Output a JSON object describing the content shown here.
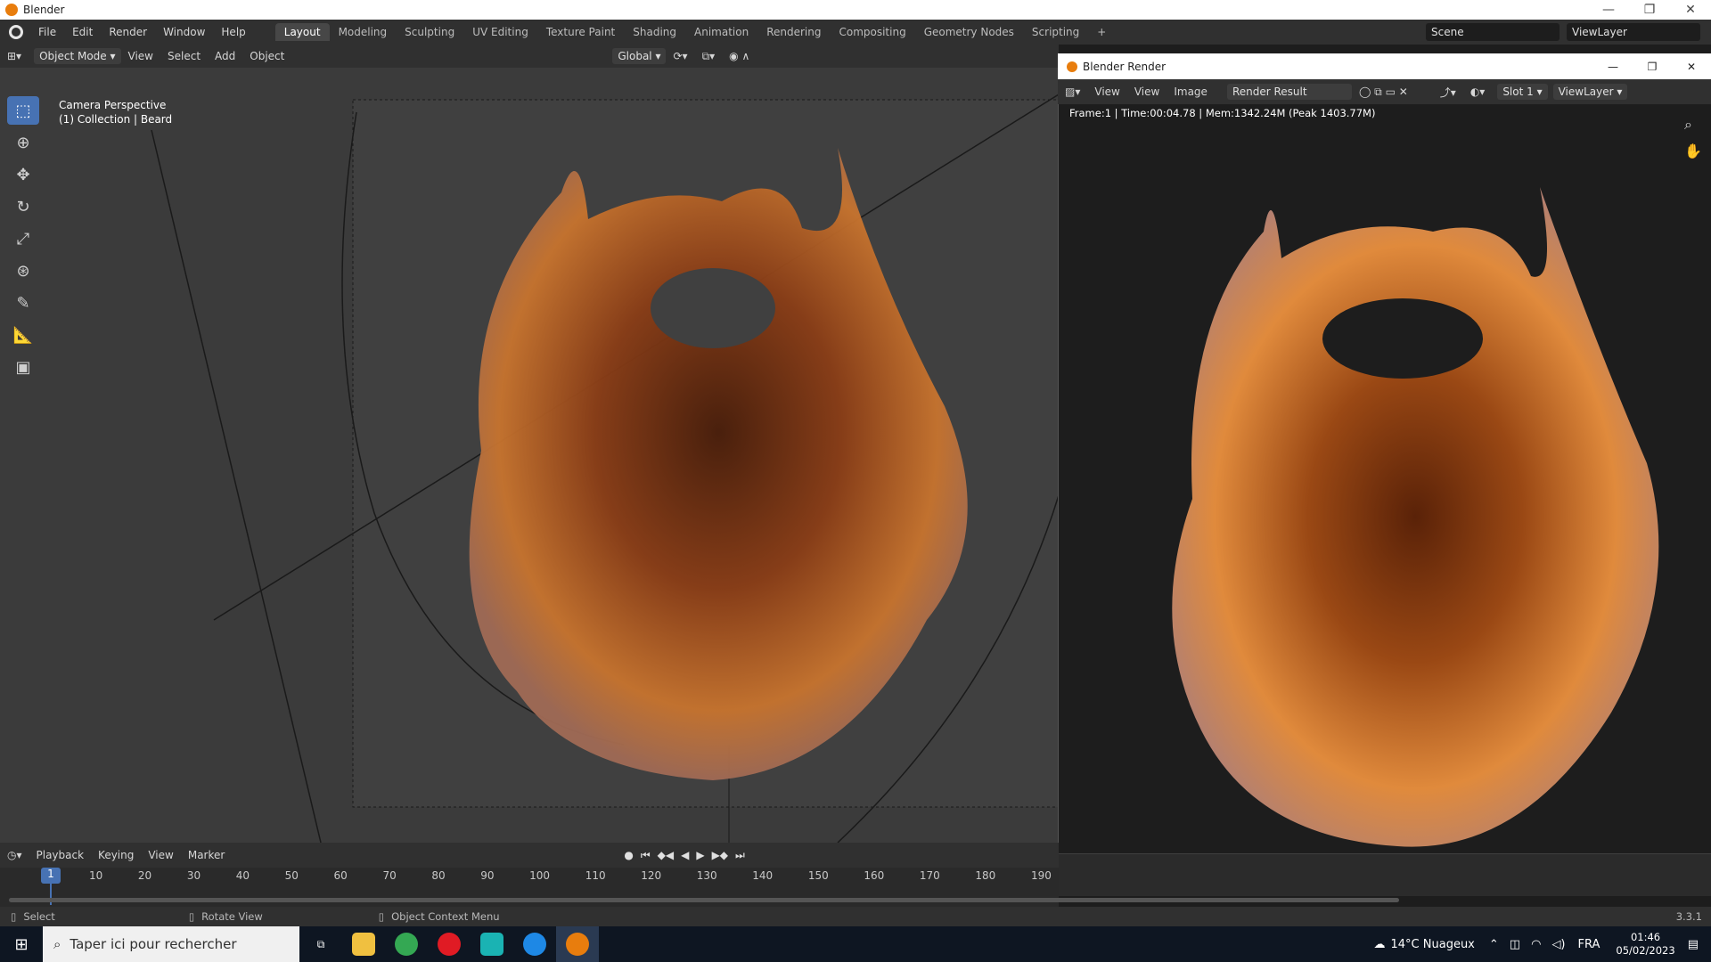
{
  "os": {
    "title": "Blender",
    "minimize": "—",
    "maximize": "❐",
    "close": "✕"
  },
  "menubar": [
    "File",
    "Edit",
    "Render",
    "Window",
    "Help"
  ],
  "workspaces": [
    "Layout",
    "Modeling",
    "Sculpting",
    "UV Editing",
    "Texture Paint",
    "Shading",
    "Animation",
    "Rendering",
    "Compositing",
    "Geometry Nodes",
    "Scripting"
  ],
  "active_workspace": "Layout",
  "scene": {
    "label": "Scene",
    "viewlayer": "ViewLayer"
  },
  "viewport_header": {
    "mode": "Object Mode",
    "menus": [
      "View",
      "Select",
      "Add",
      "Object"
    ],
    "orientation": "Global"
  },
  "viewport_overlay": {
    "line1": "Camera Perspective",
    "line2": "(1) Collection | Beard"
  },
  "render_window": {
    "title": "Blender Render",
    "menus": [
      "View",
      "View",
      "Image"
    ],
    "image_name": "Render Result",
    "slot": "Slot 1",
    "viewlayer": "ViewLayer",
    "info": "Frame:1 | Time:00:04.78 | Mem:1342.24M (Peak 1403.77M)"
  },
  "timeline": {
    "menus": [
      "Playback",
      "Keying",
      "View",
      "Marker"
    ],
    "current_frame": "1",
    "ticks": [
      "10",
      "20",
      "30",
      "40",
      "50",
      "60",
      "70",
      "80",
      "90",
      "100",
      "110",
      "120",
      "130",
      "140",
      "150",
      "160",
      "170",
      "180",
      "190"
    ]
  },
  "statusbar": {
    "select": "Select",
    "rotate": "Rotate View",
    "context": "Object Context Menu",
    "version": "3.3.1"
  },
  "taskbar": {
    "search_placeholder": "Taper ici pour rechercher",
    "weather": "14°C  Nuageux",
    "lang": "FRA",
    "time": "01:46",
    "date": "05/02/2023"
  },
  "colors": {
    "accent": "#4772b3",
    "beard_dark": "#6b2a10",
    "beard_light": "#e58a3a"
  }
}
